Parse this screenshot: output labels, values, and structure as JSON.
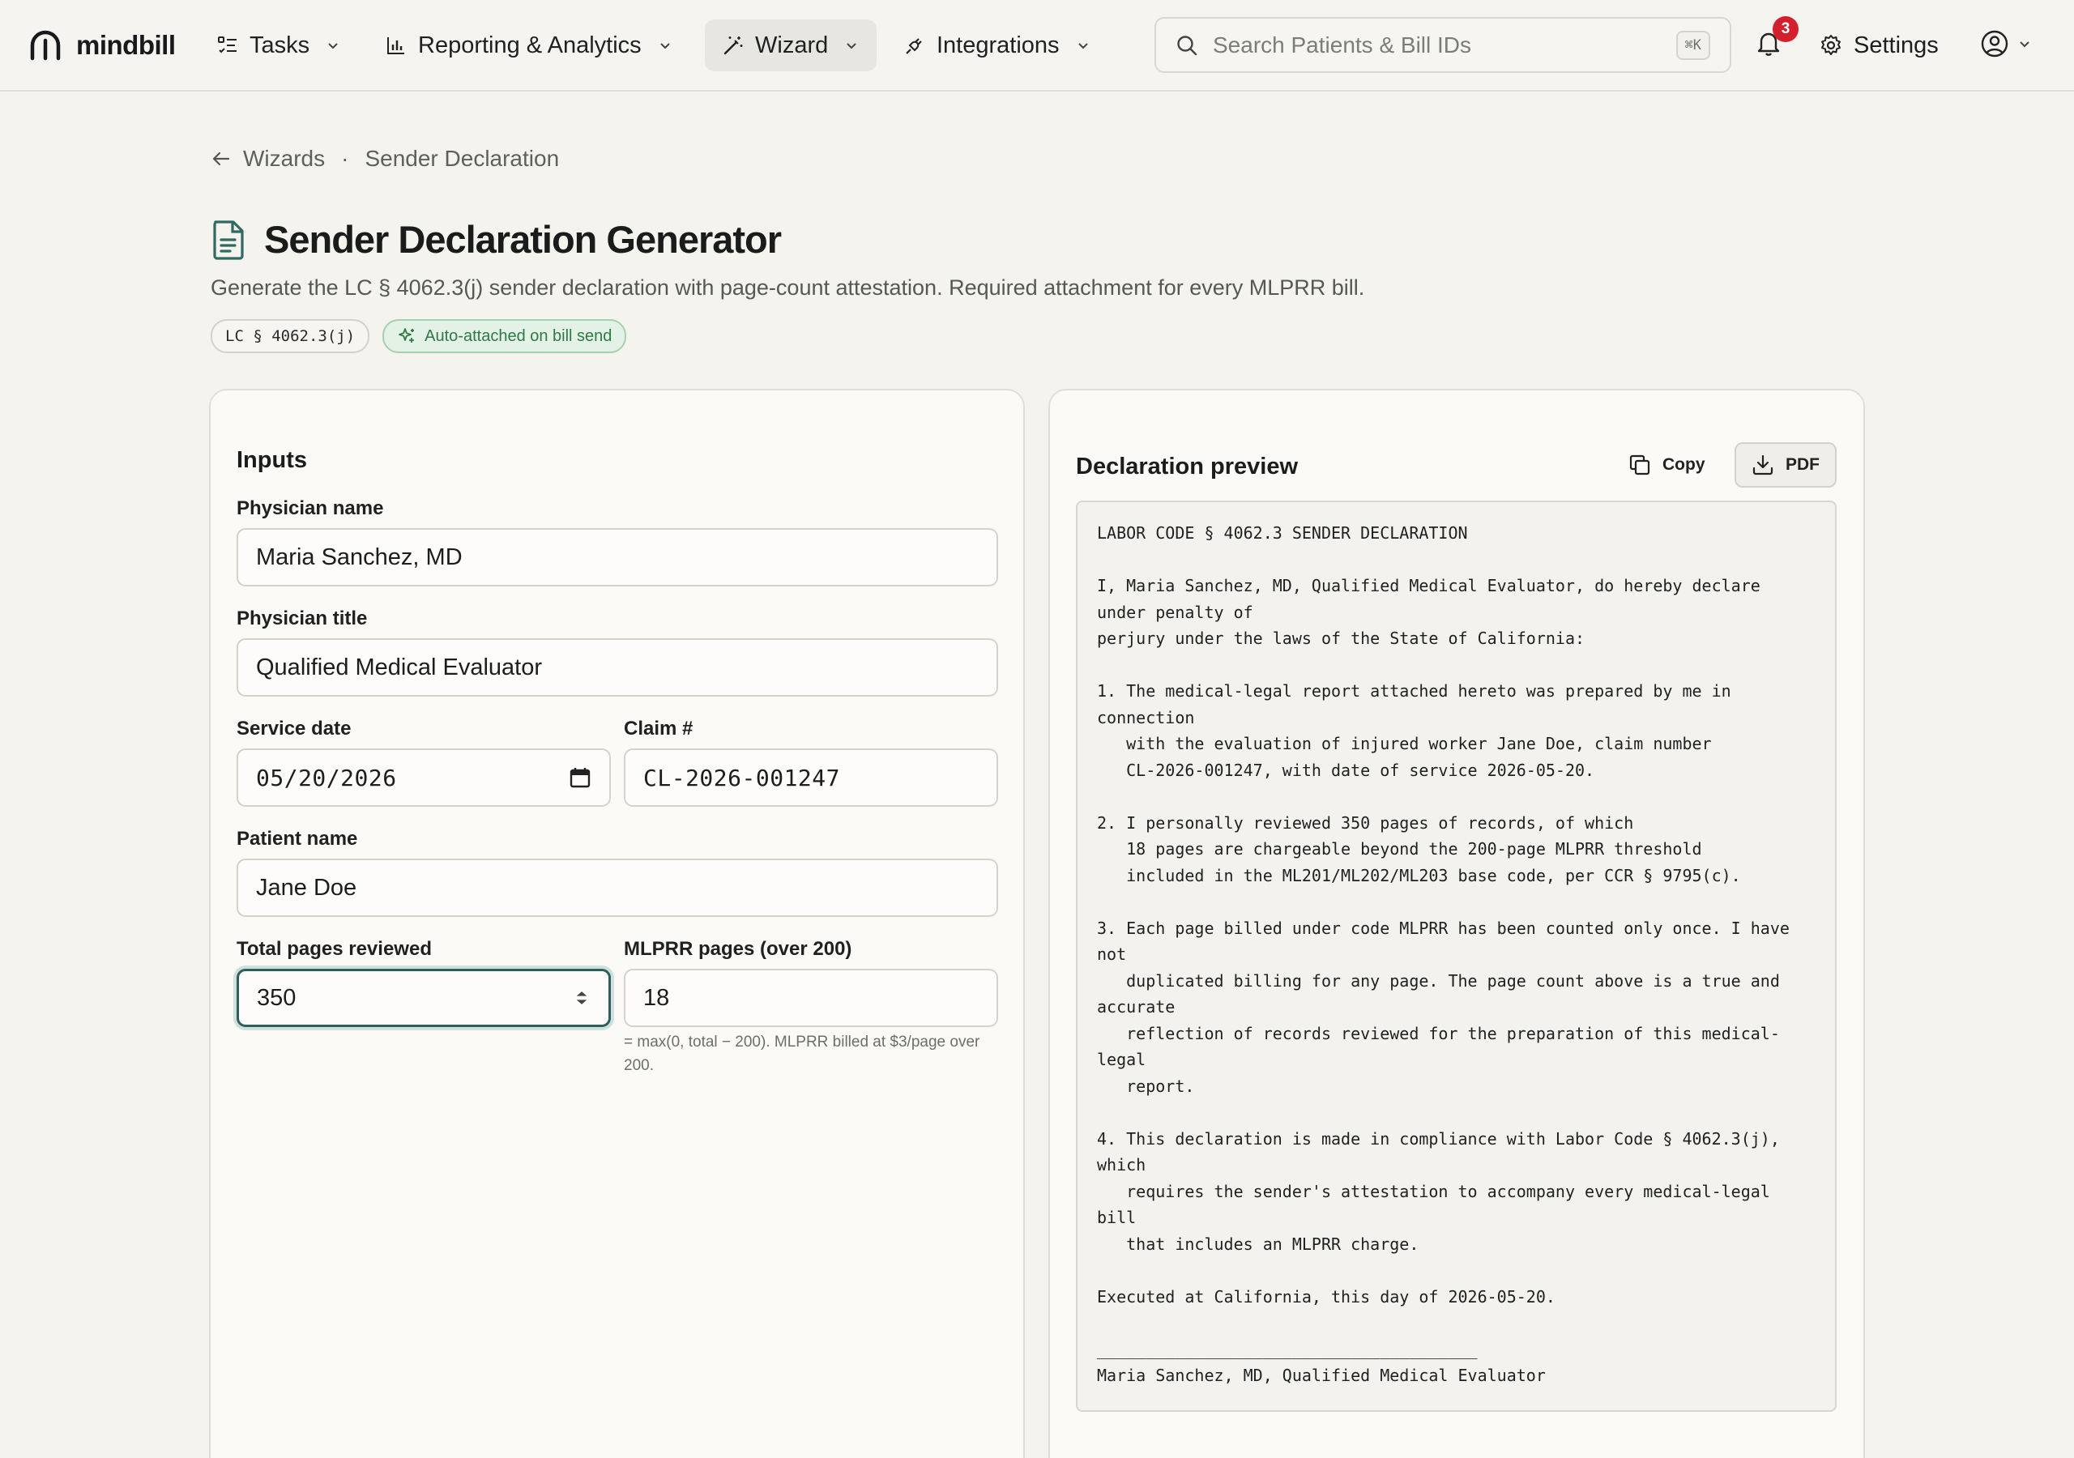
{
  "nav": {
    "brand": "mindbill",
    "items": [
      {
        "label": "Tasks",
        "icon": "tasks-icon"
      },
      {
        "label": "Reporting & Analytics",
        "icon": "bar-chart-icon"
      },
      {
        "label": "Wizard",
        "icon": "magic-wand-icon",
        "active": true
      },
      {
        "label": "Integrations",
        "icon": "plug-icon"
      }
    ],
    "search_placeholder": "Search Patients & Bill IDs",
    "search_shortcut": "⌘K",
    "notifications_count": "3",
    "settings_label": "Settings"
  },
  "breadcrumb": {
    "parent": "Wizards",
    "separator": "·",
    "current": "Sender Declaration"
  },
  "header": {
    "title": "Sender Declaration Generator",
    "subtitle": "Generate the LC § 4062.3(j) sender declaration with page-count attestation. Required attachment for every MLPRR bill.",
    "tag_code": "LC § 4062.3(j)",
    "tag_auto": "Auto-attached on bill send"
  },
  "inputs": {
    "title": "Inputs",
    "physician_name": {
      "label": "Physician name",
      "value": "Maria Sanchez, MD"
    },
    "physician_title": {
      "label": "Physician title",
      "value": "Qualified Medical Evaluator"
    },
    "service_date": {
      "label": "Service date",
      "value": "05/20/2026"
    },
    "claim": {
      "label": "Claim #",
      "value": "CL-2026-001247"
    },
    "patient_name": {
      "label": "Patient name",
      "value": "Jane Doe"
    },
    "total_pages": {
      "label": "Total pages reviewed",
      "value": "350"
    },
    "mlprr_pages": {
      "label": "MLPRR pages (over 200)",
      "value": "18"
    },
    "mlprr_hint": "= max(0, total − 200). MLPRR billed at $3/page over 200."
  },
  "preview": {
    "title": "Declaration preview",
    "copy_label": "Copy",
    "pdf_label": "PDF",
    "text": "LABOR CODE § 4062.3 SENDER DECLARATION\n\nI, Maria Sanchez, MD, Qualified Medical Evaluator, do hereby declare\nunder penalty of\nperjury under the laws of the State of California:\n\n1. The medical-legal report attached hereto was prepared by me in\nconnection\n   with the evaluation of injured worker Jane Doe, claim number\n   CL-2026-001247, with date of service 2026-05-20.\n\n2. I personally reviewed 350 pages of records, of which\n   18 pages are chargeable beyond the 200-page MLPRR threshold\n   included in the ML201/ML202/ML203 base code, per CCR § 9795(c).\n\n3. Each page billed under code MLPRR has been counted only once. I have\nnot\n   duplicated billing for any page. The page count above is a true and\naccurate\n   reflection of records reviewed for the preparation of this medical-\nlegal\n   report.\n\n4. This declaration is made in compliance with Labor Code § 4062.3(j),\nwhich\n   requires the sender's attestation to accompany every medical-legal\nbill\n   that includes an MLPRR charge.\n\nExecuted at California, this day of 2026-05-20.\n\n_______________________________________\nMaria Sanchez, MD, Qualified Medical Evaluator"
  }
}
